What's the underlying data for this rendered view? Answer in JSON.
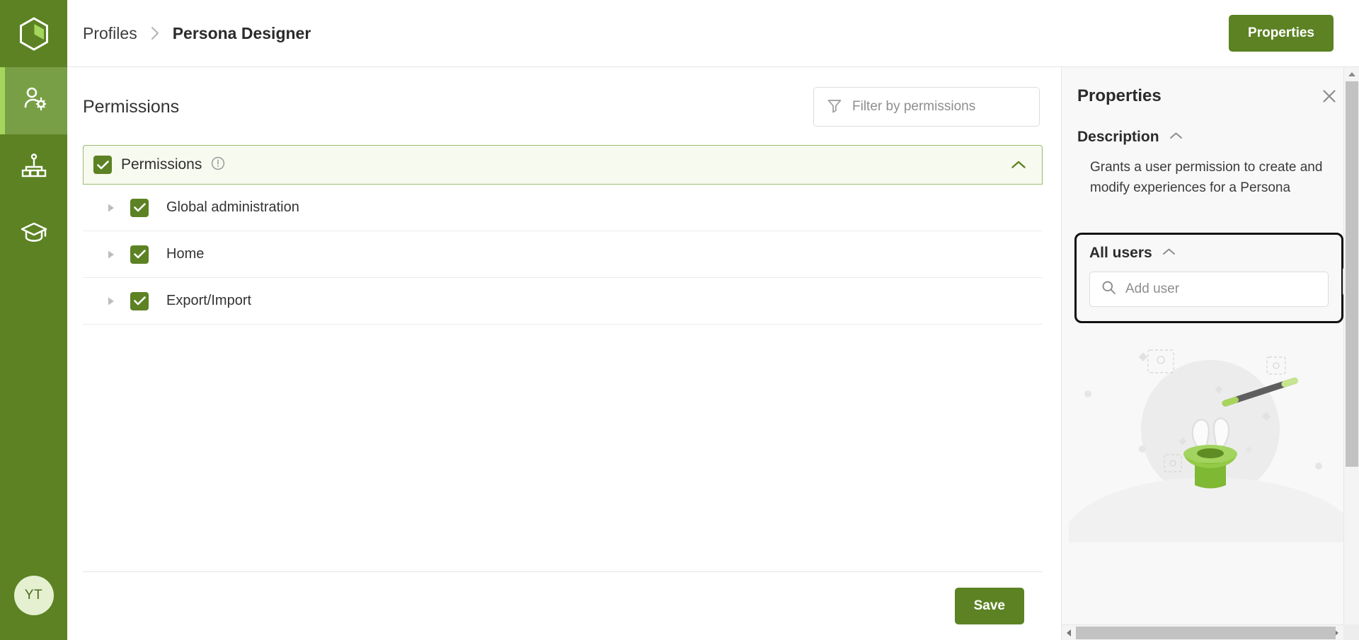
{
  "brand": {
    "accent": "#5c8223",
    "accent_light": "#a4d65e",
    "rail_active": "#789f45"
  },
  "rail": {
    "logo_name": "hexagon-logo",
    "items": [
      {
        "name": "user-admin-icon",
        "active": true
      },
      {
        "name": "org-chart-icon",
        "active": false
      },
      {
        "name": "graduation-cap-icon",
        "active": false
      }
    ],
    "avatar_initials": "YT"
  },
  "topbar": {
    "breadcrumb": [
      "Profiles",
      "Persona Designer"
    ],
    "properties_button": "Properties"
  },
  "permissions": {
    "heading": "Permissions",
    "filter_placeholder": "Filter by permissions",
    "group": {
      "label": "Permissions",
      "checked": true,
      "expanded": true
    },
    "rows": [
      {
        "label": "Global administration",
        "checked": true,
        "expanded": false
      },
      {
        "label": "Home",
        "checked": true,
        "expanded": false
      },
      {
        "label": "Export/Import",
        "checked": true,
        "expanded": false
      }
    ],
    "save_button": "Save"
  },
  "properties": {
    "title": "Properties",
    "description_section": "Description",
    "description_text": "Grants a user permission to create and modify experiences for a Persona",
    "all_users_section": "All users",
    "add_user_placeholder": "Add user"
  }
}
